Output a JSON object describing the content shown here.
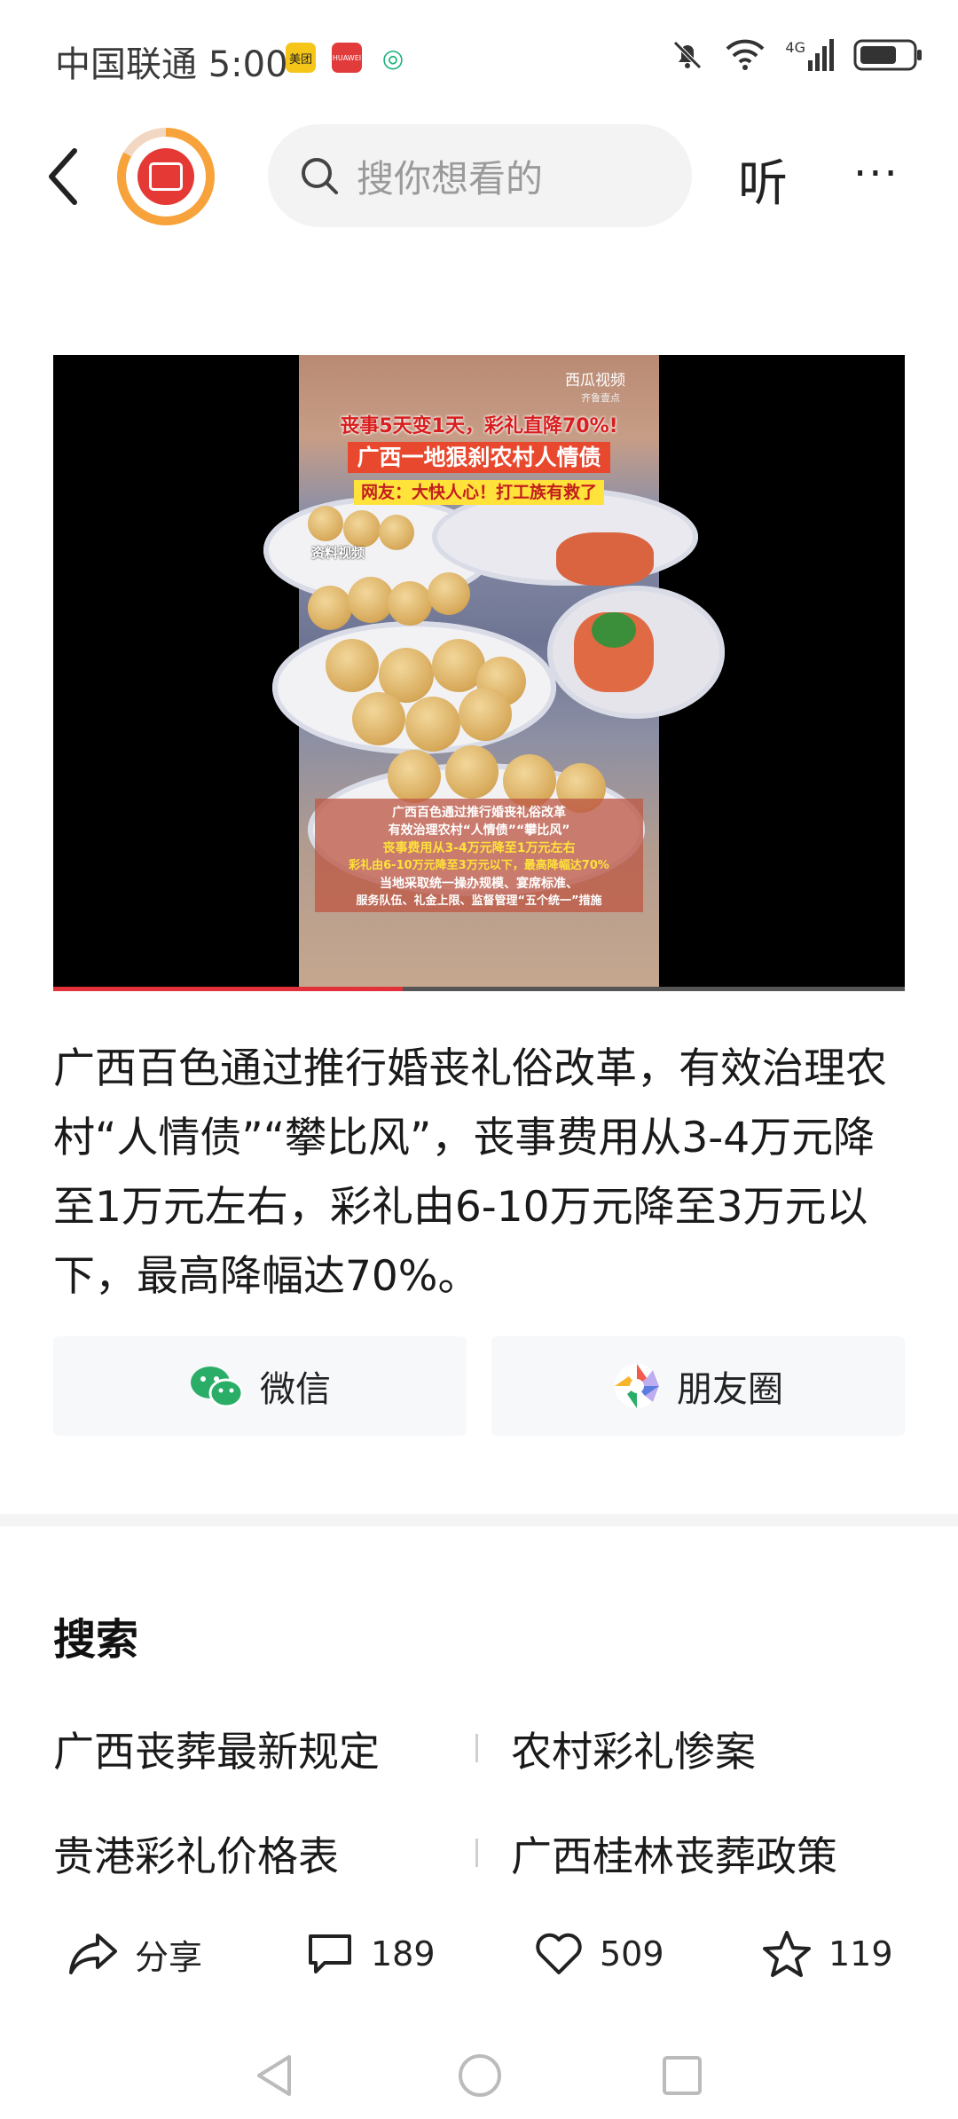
{
  "status_bar": {
    "carrier_time": "中国联通 5:00",
    "app_badges": [
      "美团",
      "HUAWEI",
      "◎"
    ],
    "network": "4G"
  },
  "header": {
    "search_placeholder": "搜你想看的",
    "listen_label": "听",
    "more_label": "···"
  },
  "video": {
    "watermark": "西瓜视频",
    "watermark_sub": "齐鲁壹点",
    "headline_line1": "丧事5天变1天，彩礼直降70%!",
    "headline_line2": "广西一地狠刹农村人情债",
    "netizen_tag": "网友：大快人心！打工族有救了",
    "source_tag": "资料视频",
    "caption_lines": [
      "广西百色通过推行婚丧礼俗改革",
      "有效治理农村“人情债”“攀比风”",
      "丧事费用从3-4万元降至1万元左右",
      "彩礼由6-10万元降至3万元以下，最高降幅达70%",
      "当地采取统一操办规模、宴席标准、",
      "服务队伍、礼金上限、监督管理“五个统一”措施"
    ],
    "progress": 0.41
  },
  "article": {
    "text": "广西百色通过推行婚丧礼俗改革，有效治理农村“人情债”“攀比风”，丧事费用从3-4万元降至1万元左右，彩礼由6-10万元降至3万元以下，最高降幅达70%。"
  },
  "share": {
    "wechat_label": "微信",
    "moments_label": "朋友圈"
  },
  "search_section": {
    "title": "搜索",
    "keywords": [
      "广西丧葬最新规定",
      "农村彩礼惨案",
      "贵港彩礼价格表",
      "广西桂林丧葬政策"
    ]
  },
  "actions": {
    "share_label": "分享",
    "comment_count": "189",
    "like_count": "509",
    "favorite_count": "119"
  },
  "colors": {
    "accent_red": "#e2313b",
    "wechat_green": "#2aae67"
  }
}
